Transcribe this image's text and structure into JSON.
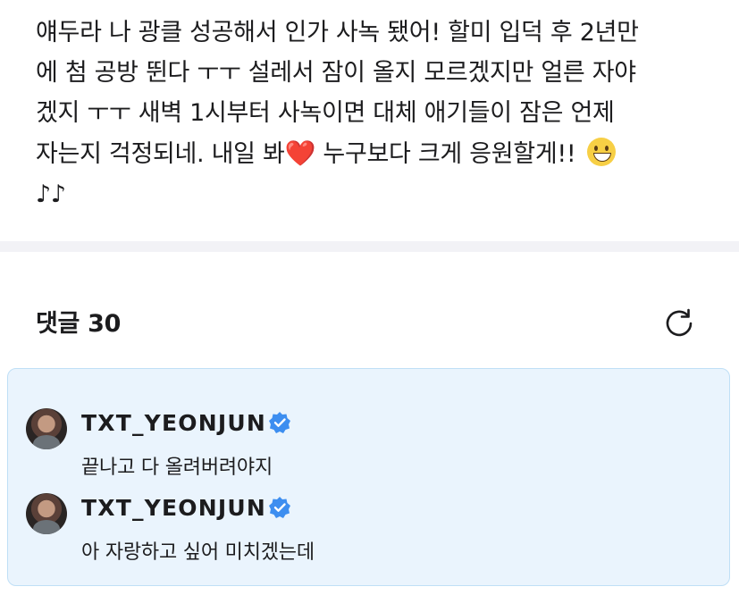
{
  "post": {
    "lines": [
      "얘두라 나 광클 성공해서 인가 사녹 됐어! 할미 입덕 후 2년만",
      "에 첨 공방 뛴다 ㅜㅜ 설레서 잠이 올지 모르겠지만 얼른 자야",
      "겠지 ㅜㅜ 새벽 1시부터 사녹이면 대체 애기들이 잠은 언제",
      "자는지 걱정되네. 내일 봐",
      "누구보다 크게 응원할게!!"
    ],
    "heart": "❤️",
    "notes": "♪♪"
  },
  "comments": {
    "title": "댓글 30",
    "replies": [
      {
        "username": "TXT_YEONJUN",
        "text": "끝나고 다 올려버려야지"
      },
      {
        "username": "TXT_YEONJUN",
        "text": "아 자랑하고 싶어 미치겠는데"
      }
    ]
  },
  "colors": {
    "verified": "#3d8ef0",
    "highlight_bg": "#eaf4fd",
    "highlight_border": "#bfdff6"
  },
  "icons": {
    "refresh": "refresh-icon",
    "verified": "verified-badge-icon",
    "grin": "grinning-face-icon"
  }
}
